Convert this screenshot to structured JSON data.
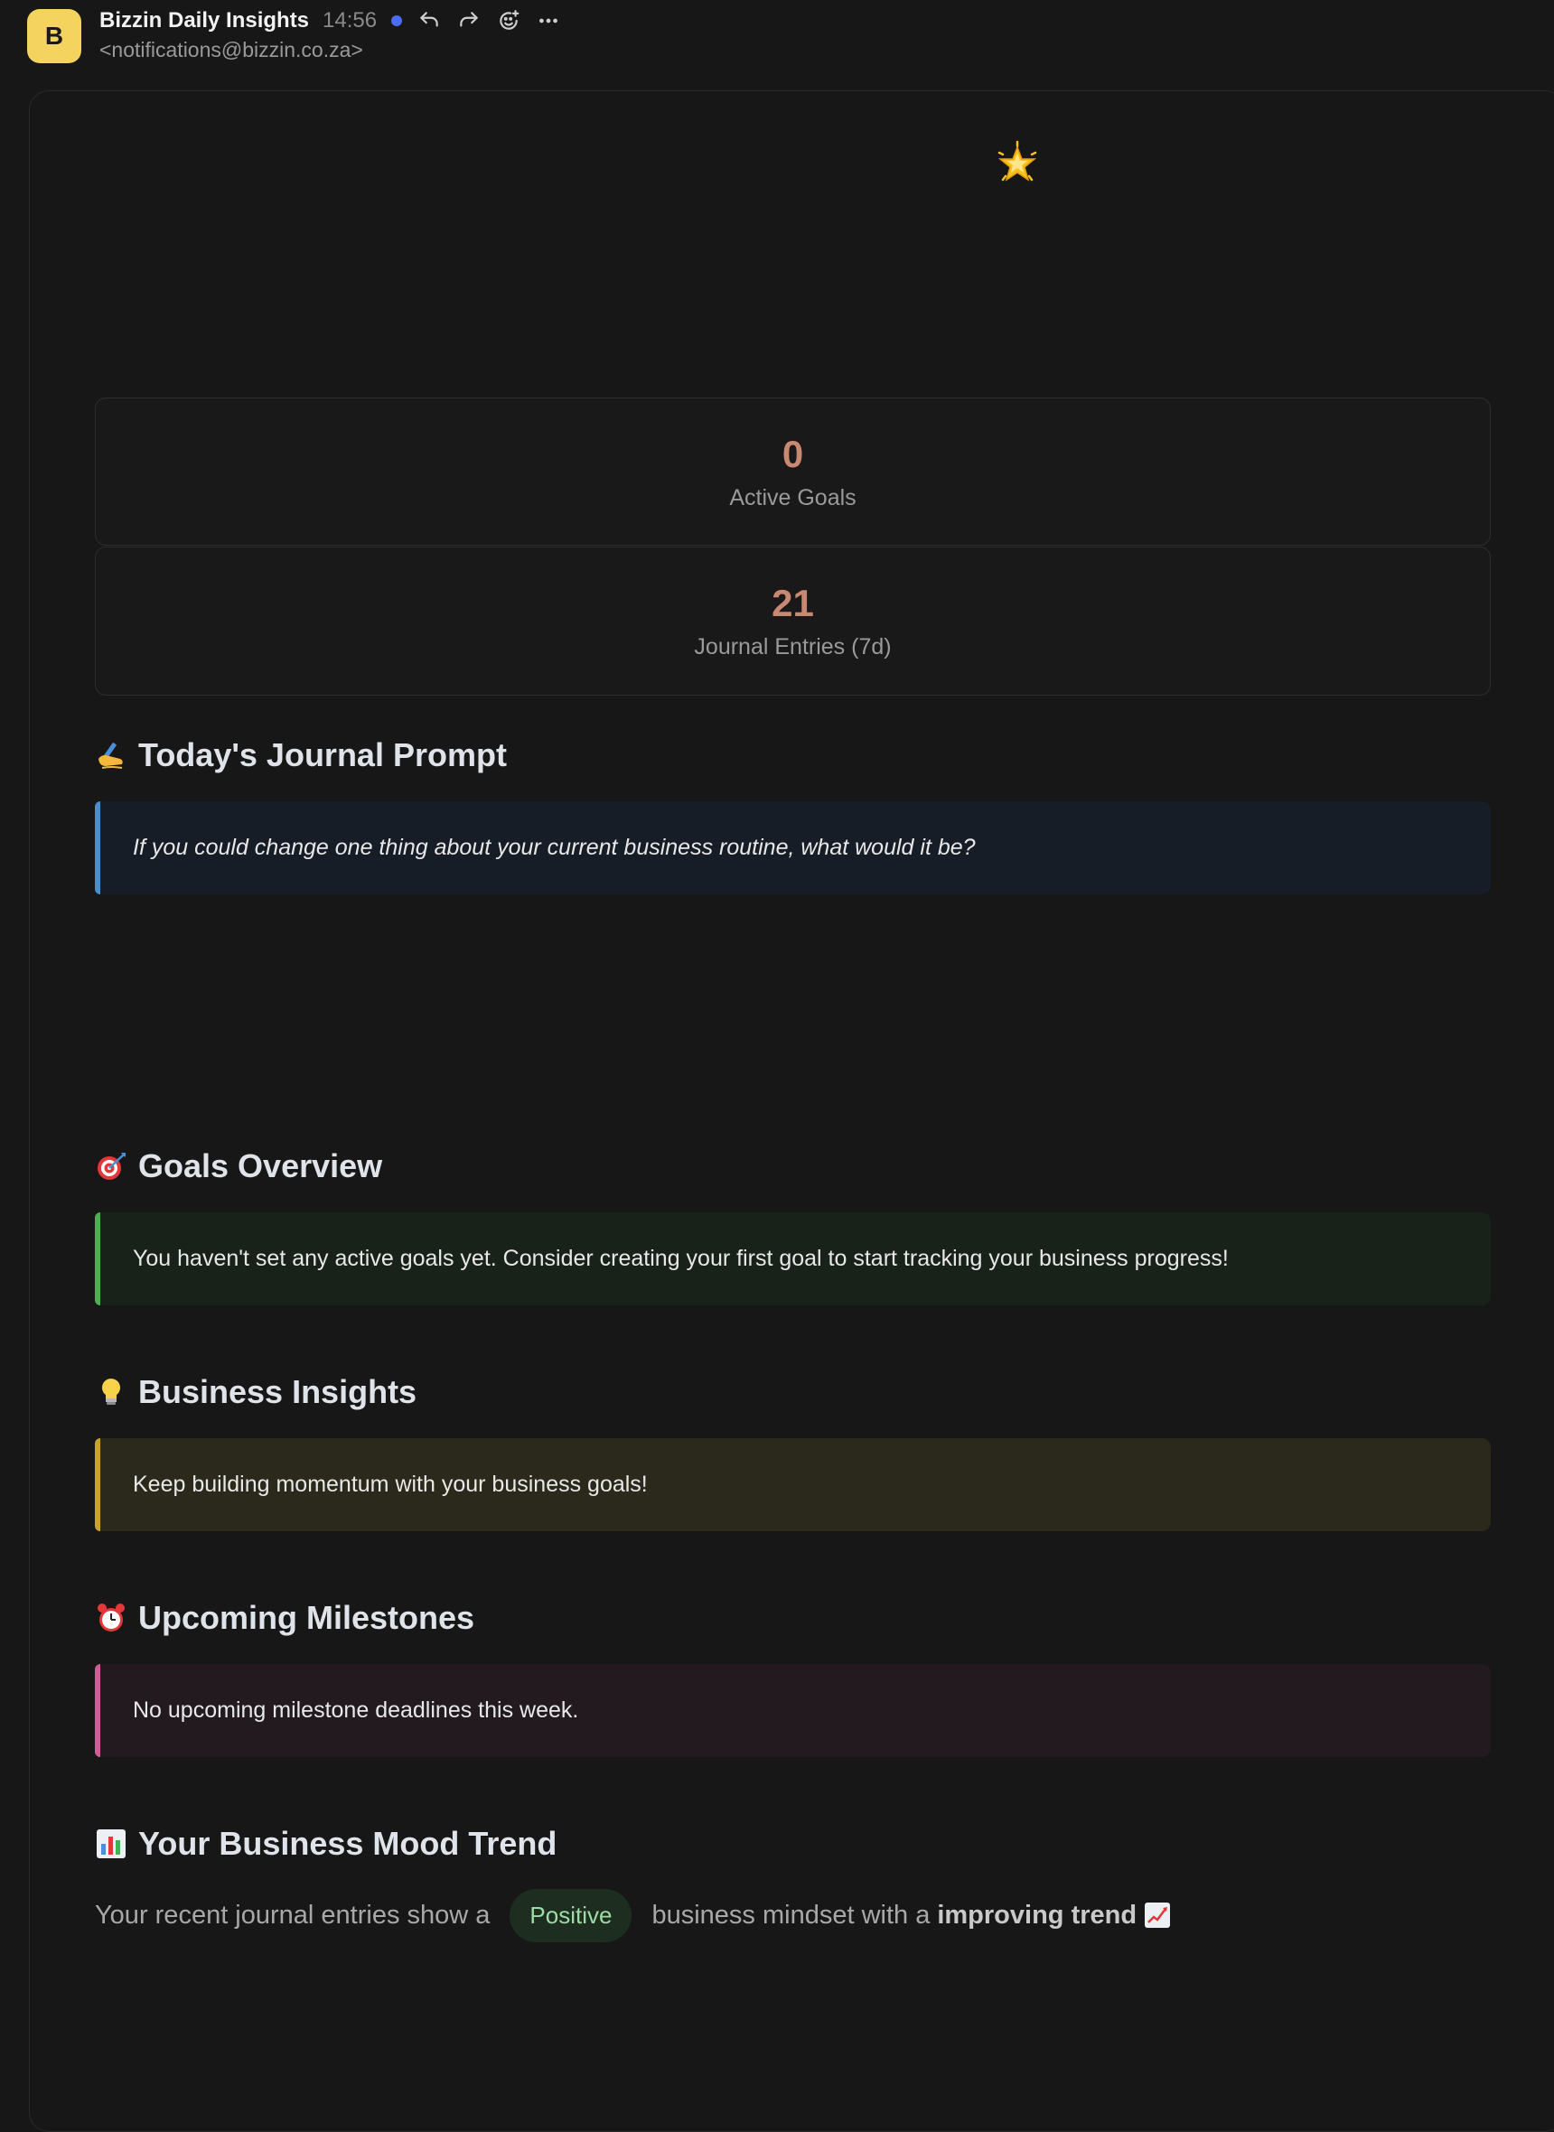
{
  "header": {
    "avatar_letter": "B",
    "sender_name": "Bizzin Daily Insights",
    "time": "14:56",
    "sender_email": "<notifications@bizzin.co.za>",
    "icons": [
      "reply-icon",
      "forward-icon",
      "emoji-reaction-icon",
      "more-icon"
    ]
  },
  "stats": [
    {
      "value": "0",
      "label": "Active Goals"
    },
    {
      "value": "21",
      "label": "Journal Entries (7d)"
    }
  ],
  "journal": {
    "title": "Today's Journal Prompt",
    "prompt": "If you could change one thing about your current business routine, what would it be?"
  },
  "goals": {
    "title": "Goals Overview",
    "text": "You haven't set any active goals yet. Consider creating your first goal to start tracking your business progress!"
  },
  "insights": {
    "title": "Business Insights",
    "text": "Keep building momentum with your business goals!"
  },
  "milestones": {
    "title": "Upcoming Milestones",
    "text": "No upcoming milestone deadlines this week."
  },
  "mood": {
    "title": "Your Business Mood Trend",
    "prefix": "Your recent journal entries show a",
    "badge": "Positive",
    "middle": "business mindset with a",
    "trend": "improving trend"
  },
  "colors": {
    "accent_stat": "#c98872",
    "prompt_bar": "#4a8fc9",
    "goals_bar": "#4caf50",
    "insights_bar": "#c9a227",
    "milestones_bar": "#d05d98",
    "unread_dot": "#4a6cf7"
  }
}
